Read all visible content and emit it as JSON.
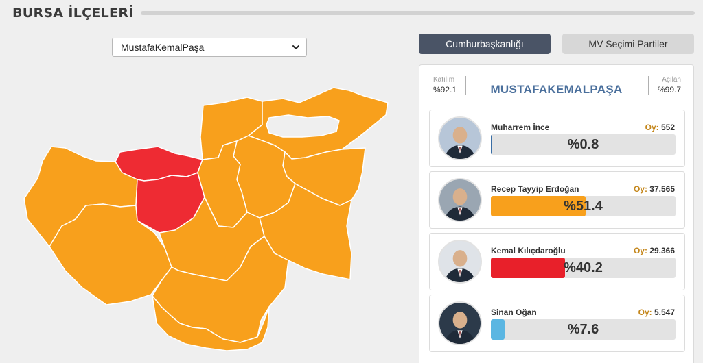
{
  "header": {
    "title": "BURSA İLÇELERİ"
  },
  "district_select": {
    "selected": "MustafaKemalPaşa"
  },
  "tabs": [
    {
      "label": "Cumhurbaşkanlığı",
      "active": true
    },
    {
      "label": "MV Seçimi Partiler",
      "active": false
    }
  ],
  "map": {
    "colors": {
      "default": "#f8a01c",
      "highlight": "#ee2b33",
      "border": "#ffffff"
    }
  },
  "summary": {
    "turnout_label": "Katılım",
    "turnout_value": "%92.1",
    "district_name": "MUSTAFAKEMALPAŞA",
    "opened_label": "Açılan",
    "opened_value": "%99.7"
  },
  "candidates": [
    {
      "name": "Muharrem İnce",
      "votes_label": "Oy:",
      "votes": "552",
      "percent_text": "%0.8",
      "percent": 0.8,
      "color": "#3a6ea5",
      "avatar": "muharrem-ince-photo"
    },
    {
      "name": "Recep Tayyip Erdoğan",
      "votes_label": "Oy:",
      "votes": "37.565",
      "percent_text": "%51.4",
      "percent": 51.4,
      "color": "#f8a01c",
      "avatar": "recep-tayyip-erdogan-photo"
    },
    {
      "name": "Kemal Kılıçdaroğlu",
      "votes_label": "Oy:",
      "votes": "29.366",
      "percent_text": "%40.2",
      "percent": 40.2,
      "color": "#e8202a",
      "avatar": "kemal-kilicdaroglu-photo"
    },
    {
      "name": "Sinan Oğan",
      "votes_label": "Oy:",
      "votes": "5.547",
      "percent_text": "%7.6",
      "percent": 7.6,
      "color": "#5bb6e2",
      "avatar": "sinan-ogan-photo"
    }
  ]
}
